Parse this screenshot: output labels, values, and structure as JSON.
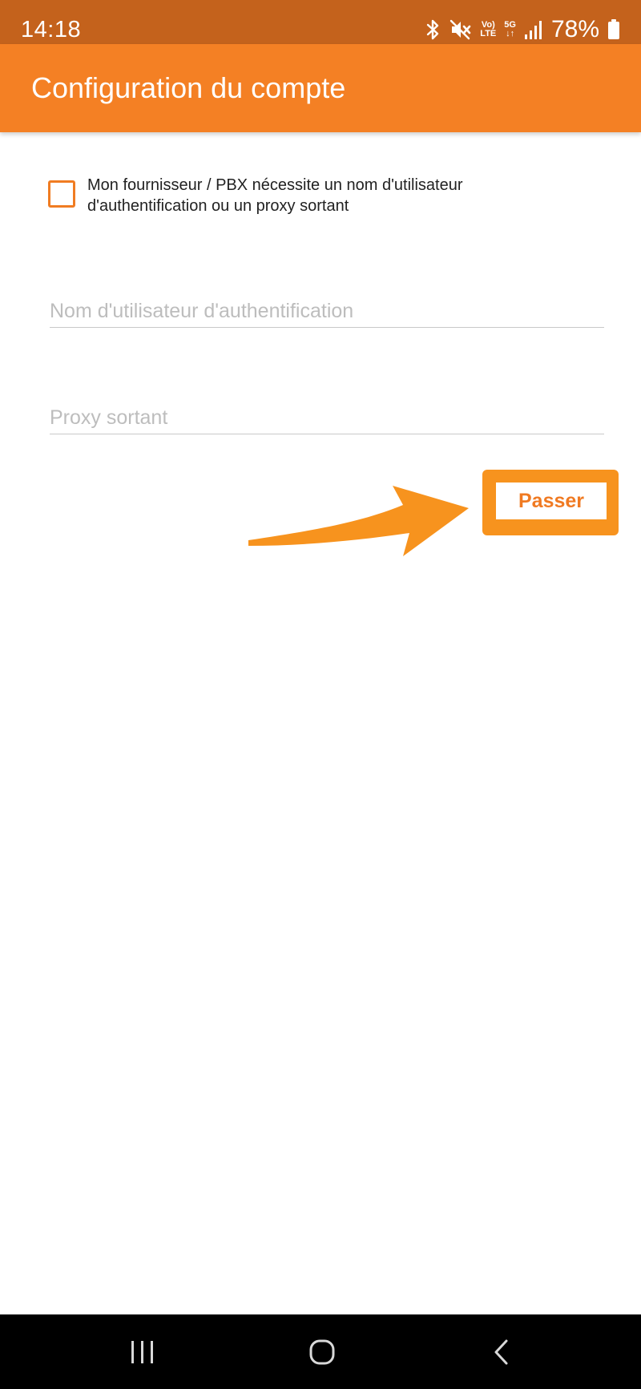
{
  "status_bar": {
    "time": "14:18",
    "lte_top": "Vo)",
    "lte_bottom": "LTE",
    "network": "5G",
    "battery_percent": "78%",
    "icons": [
      "bluetooth-icon",
      "muted-volume-icon",
      "volte-icon",
      "5g-icon",
      "signal-icon",
      "battery-icon"
    ]
  },
  "app_bar": {
    "title": "Configuration du compte",
    "color": "#f48024"
  },
  "form": {
    "checkbox_label": "Mon fournisseur / PBX nécessite un nom d'utilisateur d'authentification ou un proxy sortant",
    "checkbox_checked": false,
    "auth_username": {
      "placeholder": "Nom d'utilisateur d'authentification",
      "value": ""
    },
    "outbound_proxy": {
      "placeholder": "Proxy sortant",
      "value": ""
    },
    "skip_label": "Passer"
  },
  "annotation": {
    "color": "#f7931e",
    "icon": "arrow-icon"
  },
  "nav_bar": {
    "icons": [
      "recent-apps-icon",
      "home-icon",
      "back-icon"
    ]
  }
}
